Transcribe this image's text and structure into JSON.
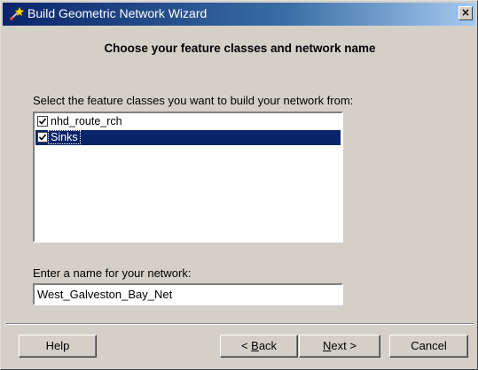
{
  "window": {
    "title": "Build Geometric Network Wizard",
    "close_label": "×"
  },
  "heading": "Choose your feature classes and network name",
  "feature_classes": {
    "label": "Select the feature classes you want to build your network from:",
    "items": [
      {
        "label": "nhd_route_rch",
        "checked": true,
        "selected": false
      },
      {
        "label": "Sinks",
        "checked": true,
        "selected": true
      }
    ]
  },
  "network_name": {
    "label": "Enter a name for your network:",
    "value": "West_Galveston_Bay_Net"
  },
  "buttons": {
    "help": "Help",
    "back_prefix": "< ",
    "back_accel": "B",
    "back_rest": "ack",
    "next_accel": "N",
    "next_rest": "ext >",
    "cancel": "Cancel"
  },
  "colors": {
    "title_bar_start": "#0a246a",
    "title_bar_end": "#a6caf0",
    "selection": "#0a246a",
    "dialog_face": "#d4d0c8"
  },
  "icons": {
    "title": "network-wizard-icon",
    "close": "close-icon",
    "checkbox": "checkmark-icon"
  }
}
